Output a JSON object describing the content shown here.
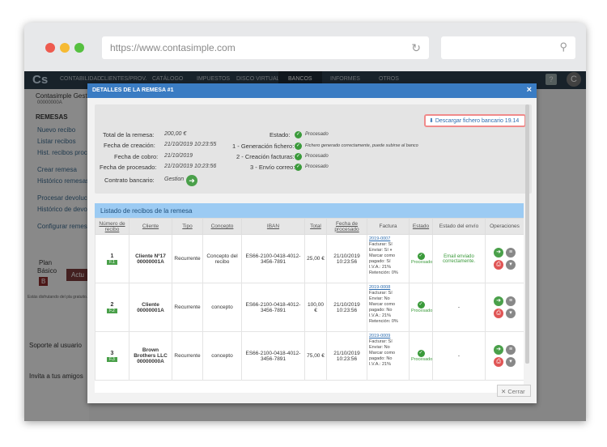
{
  "browser": {
    "url": "https://www.contasimple.com"
  },
  "nav": {
    "logo": "Cs",
    "items": [
      "CONTABILIDAD",
      "CLIENTES/PROV.",
      "CATÁLOGO",
      "IMPUESTOS",
      "DISCO VIRTUAL",
      "BANCOS",
      "INFORMES",
      "OTROS"
    ],
    "help": "?",
    "avatar": "C"
  },
  "sidebar": {
    "company": "Contasimple Gest",
    "company_id": "00000000A",
    "section": "REMESAS",
    "links": [
      "Nuevo recibo",
      "Listar recibos",
      "Hist. recibos proce",
      "Crear remesa",
      "Histórico remesas",
      "Procesar devolucio",
      "Histórico de devolu",
      "Configurar remesa"
    ],
    "plan_label": "Plan",
    "plan_name": "Básico",
    "plan_badge": "B",
    "plan_btn": "Actu",
    "plan_note": "Estás disfrutando del pla gratuito.",
    "support": "Soporte al usuario",
    "invite": "Invita a tus amigos"
  },
  "modal": {
    "title": "DETALLES DE LA REMESA #1",
    "close": "×",
    "download": "Descargar fichero bancario 19.14",
    "total_label": "Total de la remesa:",
    "total_value": "200,00 €",
    "created_label": "Fecha de creación:",
    "created_value": "21/10/2019 10:23:55",
    "charge_label": "Fecha de cobro:",
    "charge_value": "21/10/2019",
    "processed_label": "Fecha de procesado:",
    "processed_value": "21/10/2019 10:23:56",
    "contract_label": "Contrato bancario:",
    "contract_value": "Gestion",
    "state_label": "Estado:",
    "state_value": "Procesado",
    "step1_label": "1 - Generación fichero:",
    "step1_value": "Fichero generado correctamente, puede subirse al banco",
    "step2_label": "2 - Creación facturas:",
    "step2_value": "Procesado",
    "step3_label": "3 - Envío correo:",
    "step3_value": "Procesado",
    "list_title": "Listado de recibos de la remesa",
    "cancel": "Cerrar"
  },
  "table": {
    "headers": [
      "Número de recibo",
      "Cliente",
      "Tipo",
      "Concepto",
      "IBAN",
      "Total",
      "Fecha de procesado",
      "Factura",
      "Estado",
      "Estado del envío",
      "Operaciones"
    ],
    "rows": [
      {
        "num": "1",
        "tag": "F.1",
        "cliente": "Cliente Nº17 00000001A",
        "tipo": "Recurrente",
        "concepto": "Concepto del recibo",
        "iban": "ES66-2100-0418-4012-3456-7891",
        "total": "25,00 €",
        "fecha": "21/10/2019 10:23:56",
        "factura_link": "2019-0007",
        "factura_lines": [
          "Facturar: Sí",
          "Enviar: Sí",
          "Marcar como pagado: Sí",
          "I.V.A.: 21%",
          "Retención: 0%"
        ],
        "estado": "Procesado",
        "envio": "Email enviado correctamente."
      },
      {
        "num": "2",
        "tag": "F.2",
        "cliente": "Cliente 00000001A",
        "tipo": "Recurrente",
        "concepto": "concepto",
        "iban": "ES66-2100-0418-4012-3456-7891",
        "total": "100,00 €",
        "fecha": "21/10/2019 10:23:56",
        "factura_link": "2019-0008",
        "factura_lines": [
          "Facturar: Sí",
          "Enviar: No",
          "Marcar como pagado: No",
          "I.V.A.: 21%",
          "Retención: 0%"
        ],
        "estado": "Procesado",
        "envio": "-"
      },
      {
        "num": "3",
        "tag": "F.3",
        "cliente": "Brown Brothers LLC 00000000A",
        "tipo": "Recurrente",
        "concepto": "concepto",
        "iban": "ES66-2100-0418-4012-3456-7891",
        "total": "75,00 €",
        "fecha": "21/10/2019 10:23:56",
        "factura_link": "2019-0009",
        "factura_lines": [
          "Facturar: Sí",
          "Enviar: No",
          "Marcar como pagado: No",
          "I.V.A.: 21%"
        ],
        "estado": "Procesado",
        "envio": "-"
      }
    ]
  },
  "colors": {
    "nav": "#2d3e4e",
    "modal_header": "#3a7cc3",
    "success": "#3a9a3a",
    "list_header": "#9ccbf3"
  }
}
